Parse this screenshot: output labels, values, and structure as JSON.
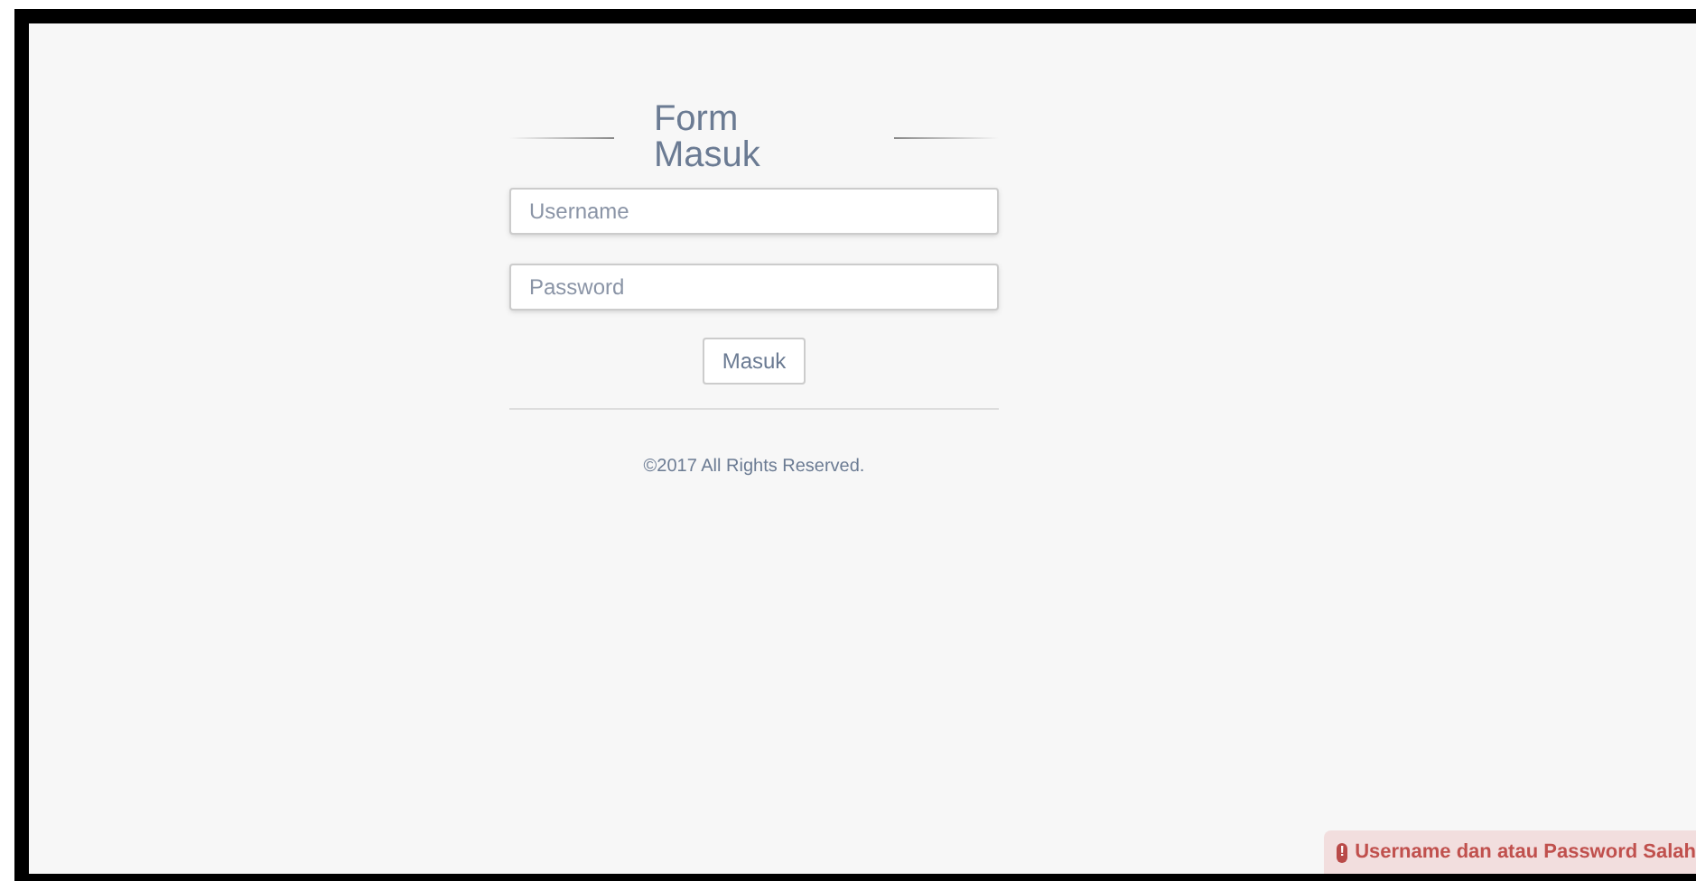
{
  "login_form": {
    "title": "Form Masuk",
    "username": {
      "placeholder": "Username"
    },
    "password": {
      "placeholder": "Password"
    },
    "submit_button": "Masuk",
    "footer": "©2017 All Rights Reserved."
  },
  "alert": {
    "icon": "!",
    "message": "Username dan atau Password Salah"
  }
}
